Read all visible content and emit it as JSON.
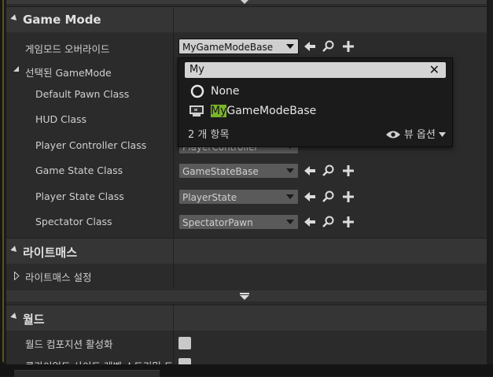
{
  "game_mode": {
    "section_title": "Game Mode",
    "override_label": "게임모드 오버라이드",
    "override_value": "MyGameModeBase",
    "selected_label": "선택된 GameMode",
    "rows": [
      {
        "label": "Default Pawn Class"
      },
      {
        "label": "HUD Class"
      },
      {
        "label": "Player Controller Class",
        "value": "PlayerController"
      },
      {
        "label": "Game State Class",
        "value": "GameStateBase"
      },
      {
        "label": "Player State Class",
        "value": "PlayerState"
      },
      {
        "label": "Spectator Class",
        "value": "SpectatorPawn"
      }
    ]
  },
  "popup": {
    "search_text": "My",
    "items": [
      {
        "label": "None",
        "icon": "none-circle-icon"
      },
      {
        "highlight": "My",
        "rest": "GameModeBase",
        "icon": "class-icon"
      }
    ],
    "count_label": "2 개 항목",
    "view_options_label": "뷰 옵션"
  },
  "lightmass": {
    "section_title": "라이트매스",
    "settings_label": "라이트매스 설정"
  },
  "world": {
    "section_title": "월드",
    "composition_label": "월드 컴포지션 활성화",
    "partial_label": "클라이언트 사이드 레벨 스트리밍 트"
  },
  "colors": {
    "highlight": "#7ab32c",
    "panel": "#2b2b2b",
    "section": "#353535"
  }
}
